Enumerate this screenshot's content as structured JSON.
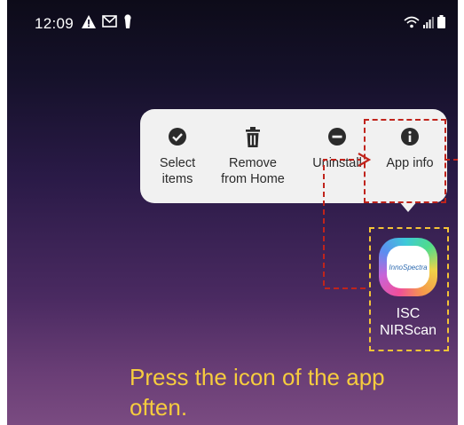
{
  "status_bar": {
    "time": "12:09",
    "left_icons": [
      "warning-icon",
      "gmail-icon",
      "keyhole-icon"
    ],
    "right_icons": [
      "wifi-icon",
      "signal-icon",
      "battery-icon"
    ]
  },
  "context_menu": {
    "items": [
      {
        "label_line1": "Select",
        "label_line2": "items",
        "icon": "check-circle-icon"
      },
      {
        "label_line1": "Remove",
        "label_line2": "from Home",
        "icon": "trash-icon"
      },
      {
        "label_line1": "Uninstall",
        "label_line2": "",
        "icon": "minus-circle-icon"
      },
      {
        "label_line1": "App info",
        "label_line2": "",
        "icon": "info-circle-icon"
      }
    ]
  },
  "app": {
    "name_line1": "ISC",
    "name_line2": "NIRScan",
    "logo_text": "InnoSpectra"
  },
  "annotation": {
    "caption": "Press the icon of the app often.",
    "highlight_color": "#c0241c",
    "app_box_color": "#f5c436",
    "caption_color": "#f6cc3e"
  }
}
